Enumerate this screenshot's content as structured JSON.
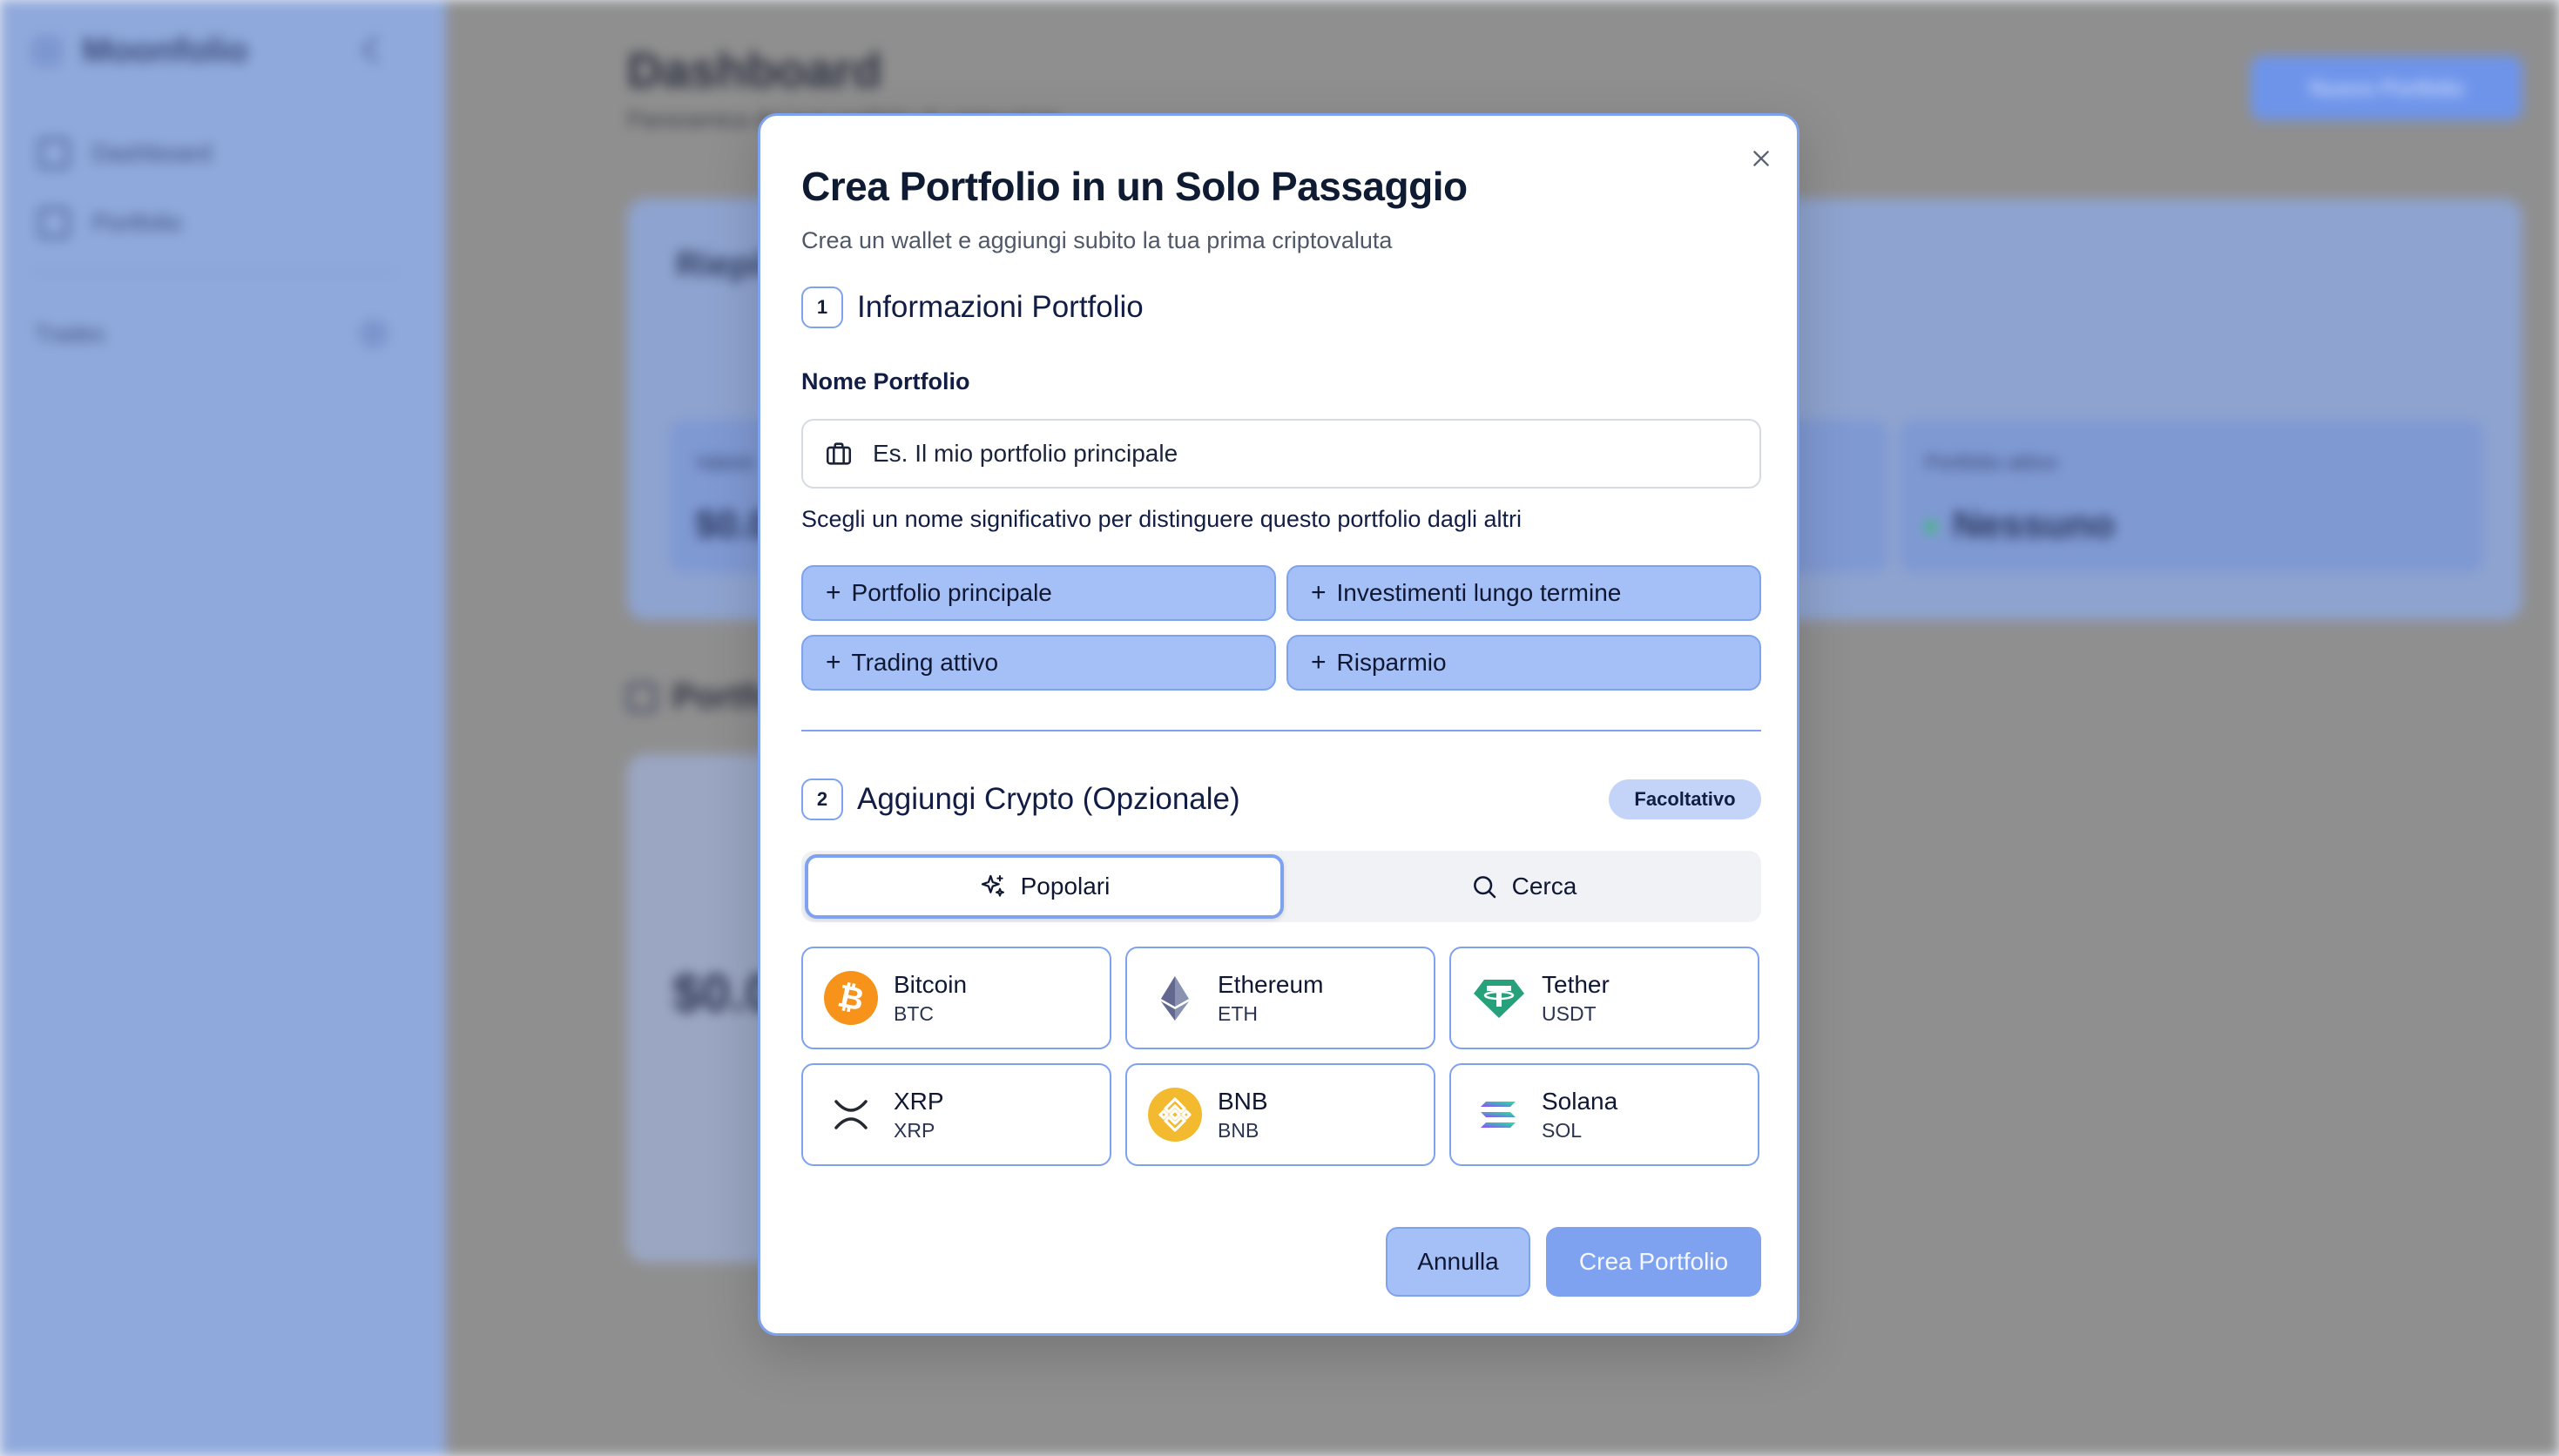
{
  "background": {
    "app_name": "Moonfolio",
    "nav": [
      {
        "label": "Dashboard",
        "icon": "grid-icon"
      },
      {
        "label": "Portfolio",
        "icon": "wallet-icon"
      }
    ],
    "section_label": "Trades",
    "page_title": "Dashboard",
    "page_subtitle": "Panoramica dei tuoi portfolio di criptovalute",
    "new_button_label": "Nuovo Portfolio",
    "summary_title": "Riepilogo",
    "stats": [
      {
        "label": "Valore",
        "value": "$0.00"
      },
      {
        "label": "Portfolio attivo",
        "value": "Nessuno"
      }
    ],
    "portfolios_title": "Portfolio",
    "portfolio_amount": "$0.00"
  },
  "modal": {
    "title": "Crea Portfolio in un Solo Passaggio",
    "subtitle": "Crea un wallet e aggiungi subito la tua prima criptovaluta",
    "step1": {
      "number": "1",
      "label": "Informazioni Portfolio"
    },
    "name_field": {
      "label": "Nome Portfolio",
      "placeholder": "Es. Il mio portfolio principale",
      "value": "",
      "hint": "Scegli un nome significativo per distinguere questo portfolio dagli altri"
    },
    "suggestions": [
      "Portfolio principale",
      "Investimenti lungo termine",
      "Trading attivo",
      "Risparmio"
    ],
    "step2": {
      "number": "2",
      "label": "Aggiungi Crypto (Opzionale)",
      "badge": "Facoltativo"
    },
    "tabs": [
      {
        "label": "Popolari",
        "icon": "sparkles-icon",
        "active": true
      },
      {
        "label": "Cerca",
        "icon": "search-icon",
        "active": false
      }
    ],
    "coins": [
      {
        "name": "Bitcoin",
        "symbol": "BTC",
        "icon": "bitcoin-icon",
        "color": "#f7931a"
      },
      {
        "name": "Ethereum",
        "symbol": "ETH",
        "icon": "ethereum-icon",
        "color": "#627eea"
      },
      {
        "name": "Tether",
        "symbol": "USDT",
        "icon": "tether-icon",
        "color": "#26a17b"
      },
      {
        "name": "XRP",
        "symbol": "XRP",
        "icon": "xrp-icon",
        "color": "#23292f"
      },
      {
        "name": "BNB",
        "symbol": "BNB",
        "icon": "bnb-icon",
        "color": "#f3ba2f"
      },
      {
        "name": "Solana",
        "symbol": "SOL",
        "icon": "solana-icon",
        "color": "#9945ff"
      }
    ],
    "cancel_label": "Annulla",
    "create_label": "Crea Portfolio"
  },
  "colors": {
    "accent": "#7ea2ef",
    "chip_bg": "#a5c0f6",
    "badge_bg": "#c3d4f8"
  }
}
